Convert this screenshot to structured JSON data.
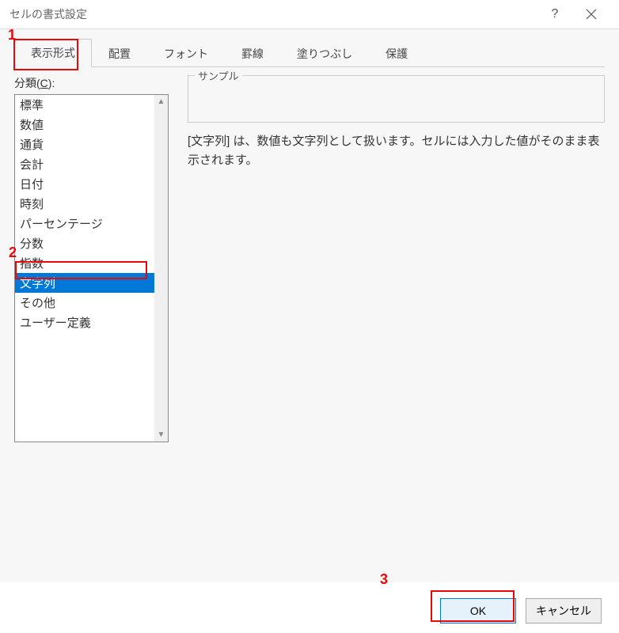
{
  "title": "セルの書式設定",
  "help_char": "?",
  "tabs": [
    {
      "label": "表示形式",
      "active": true
    },
    {
      "label": "配置",
      "active": false
    },
    {
      "label": "フォント",
      "active": false
    },
    {
      "label": "罫線",
      "active": false
    },
    {
      "label": "塗りつぶし",
      "active": false
    },
    {
      "label": "保護",
      "active": false
    }
  ],
  "category": {
    "label_prefix": "分類(",
    "label_mnemonic": "C",
    "label_suffix": "):",
    "items": [
      "標準",
      "数値",
      "通貨",
      "会計",
      "日付",
      "時刻",
      "パーセンテージ",
      "分数",
      "指数",
      "文字列",
      "その他",
      "ユーザー定義"
    ],
    "selected_index": 9
  },
  "sample": {
    "label": "サンプル",
    "value": ""
  },
  "description": "[文字列] は、数値も文字列として扱います。セルには入力した値がそのまま表示されます。",
  "buttons": {
    "ok": "OK",
    "cancel": "キャンセル"
  },
  "annotations": {
    "one": "1",
    "two": "2",
    "three": "3"
  }
}
